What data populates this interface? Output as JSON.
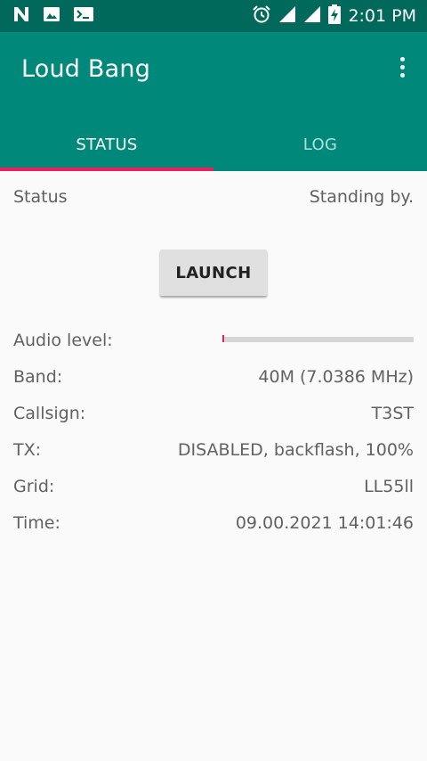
{
  "statusbar": {
    "time": "2:01 PM",
    "left_icons": [
      "n-logo-icon",
      "image-icon",
      "terminal-icon"
    ],
    "right_icons": [
      "alarm-icon",
      "signal-icon",
      "signal-icon",
      "battery-charging-icon"
    ]
  },
  "appbar": {
    "title": "Loud Bang"
  },
  "tabs": [
    {
      "label": "STATUS",
      "selected": true
    },
    {
      "label": "LOG",
      "selected": false
    }
  ],
  "status": {
    "label": "Status",
    "value": "Standing by."
  },
  "launch_button": {
    "label": "LAUNCH"
  },
  "audio": {
    "label": "Audio level:",
    "level": 0.01
  },
  "fields": [
    {
      "label": "Band:",
      "value": "40M (7.0386 MHz)"
    },
    {
      "label": "Callsign:",
      "value": "T3ST"
    },
    {
      "label": "TX:",
      "value": "DISABLED, backflash, 100%"
    },
    {
      "label": "Grid:",
      "value": "LL55ll"
    },
    {
      "label": "Time:",
      "value": "09.00.2021 14:01:46"
    }
  ],
  "colors": {
    "statusbar": "#00695c",
    "appbar": "#00897b",
    "accent": "#e91e63",
    "background": "#fafafa"
  }
}
